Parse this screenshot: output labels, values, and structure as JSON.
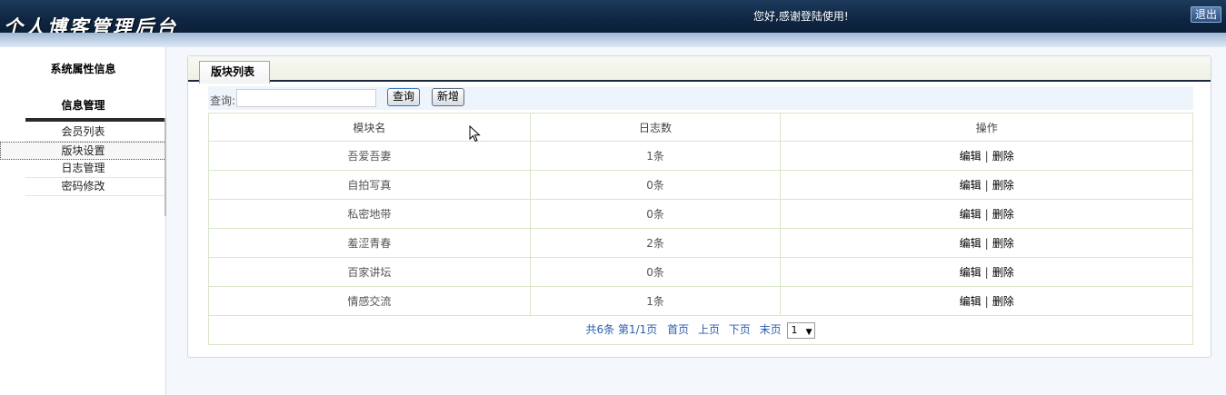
{
  "header": {
    "logo_text": "个人博客管理后台",
    "welcome": "您好,感谢登陆使用!",
    "logout_label": "退出"
  },
  "sidebar": {
    "system_title": "系统属性信息",
    "section_title": "信息管理",
    "items": [
      {
        "label": "会员列表",
        "active": false
      },
      {
        "label": "版块设置",
        "active": true
      },
      {
        "label": "日志管理",
        "active": false
      },
      {
        "label": "密码修改",
        "active": false
      }
    ]
  },
  "main": {
    "tab_label": "版块列表",
    "search": {
      "label": "查询:",
      "value": "",
      "query_button": "查询",
      "add_button": "新增"
    },
    "table": {
      "columns": [
        "模块名",
        "日志数",
        "操作"
      ],
      "rows": [
        {
          "name": "吾爱吾妻",
          "count": "1条"
        },
        {
          "name": "自拍写真",
          "count": "0条"
        },
        {
          "name": "私密地带",
          "count": "0条"
        },
        {
          "name": "羞涩青春",
          "count": "2条"
        },
        {
          "name": "百家讲坛",
          "count": "0条"
        },
        {
          "name": "情感交流",
          "count": "1条"
        }
      ],
      "edit_label": "编辑",
      "op_separator": "|",
      "delete_label": "删除"
    },
    "pager": {
      "summary": "共6条 第1/1页",
      "first": "首页",
      "prev": "上页",
      "next": "下页",
      "last": "末页",
      "page_select_value": "1"
    }
  },
  "icons": {
    "cursor": "mouse-pointer-icon",
    "dropdown": "chevron-down-icon"
  },
  "colors": {
    "header_bg": "#0f2642",
    "pager_link": "#2a5db0",
    "grid_border": "#d9e6c8"
  }
}
